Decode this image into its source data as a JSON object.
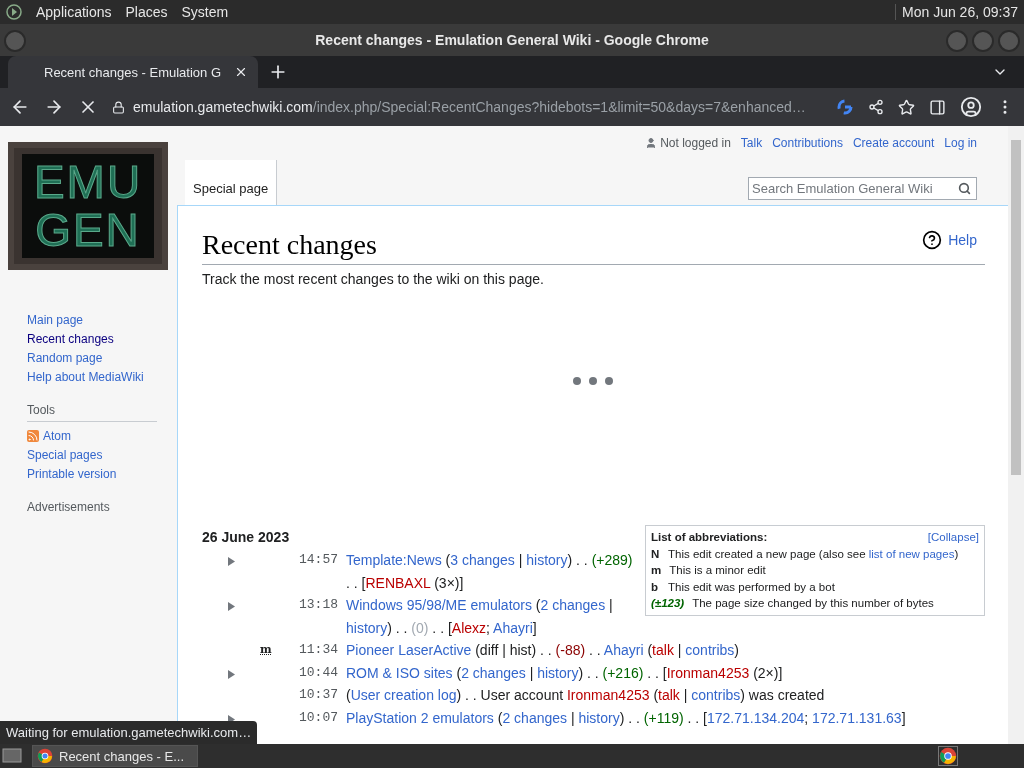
{
  "top_panel": {
    "menus": [
      "Applications",
      "Places",
      "System"
    ],
    "clock": "Mon Jun 26, 09:37"
  },
  "window": {
    "title": "Recent changes - Emulation General Wiki - Google Chrome"
  },
  "tabs": [
    {
      "label": "Recent changes - Emulation G",
      "selected": true
    }
  ],
  "address_bar": {
    "domain": "emulation.gametechwiki.com",
    "path": "/index.php/Special:RecentChanges?hidebots=1&limit=50&days=7&enhanced…"
  },
  "page": {
    "logo": [
      "EMU",
      "GEN"
    ],
    "personal_tools": [
      {
        "label": "Not logged in",
        "kind": "status"
      },
      {
        "label": "Talk",
        "kind": "link"
      },
      {
        "label": "Contributions",
        "kind": "link"
      },
      {
        "label": "Create account",
        "kind": "link"
      },
      {
        "label": "Log in",
        "kind": "link"
      }
    ],
    "namespace_tabs": [
      {
        "label": "Special page",
        "selected": true
      }
    ],
    "search": {
      "placeholder": "Search Emulation General Wiki"
    },
    "sidebar": {
      "navigation": [
        {
          "label": "Main page",
          "selected": false
        },
        {
          "label": "Recent changes",
          "selected": true
        },
        {
          "label": "Random page",
          "selected": false
        },
        {
          "label": "Help about MediaWiki",
          "selected": false
        }
      ],
      "tools_heading": "Tools",
      "tools": [
        {
          "label": "Atom",
          "kind": "feed"
        },
        {
          "label": "Special pages",
          "kind": "link"
        },
        {
          "label": "Printable version",
          "kind": "link"
        }
      ],
      "ads_heading": "Advertisements"
    },
    "heading": "Recent changes",
    "help": "Help",
    "intro": "Track the most recent changes to the wiki on this page.",
    "legend": {
      "title": "List of abbreviations:",
      "toggle": "[Collapse]",
      "items": [
        {
          "key": "N",
          "kind": "flag",
          "segments": [
            {
              "text": "This edit created a new page (also see ",
              "kind": "plain"
            },
            {
              "text": "list of new pages",
              "kind": "link"
            },
            {
              "text": ")",
              "kind": "plain"
            }
          ]
        },
        {
          "key": "m",
          "kind": "flag",
          "segments": [
            {
              "text": "This is a minor edit",
              "kind": "plain"
            }
          ]
        },
        {
          "key": "b",
          "kind": "flag",
          "segments": [
            {
              "text": "This edit was performed by a bot",
              "kind": "plain"
            }
          ]
        },
        {
          "key": "(±123)",
          "kind": "size",
          "segments": [
            {
              "text": "The page size changed by this number of bytes",
              "kind": "plain"
            }
          ]
        }
      ]
    },
    "date": "26 June 2023",
    "changes": [
      {
        "kind": "group",
        "expanded": false,
        "time": "14:57",
        "segments": [
          {
            "text": "Template:News",
            "kind": "link"
          },
          {
            "text": " (",
            "kind": "plain"
          },
          {
            "text": "3 changes",
            "kind": "link"
          },
          {
            "text": " | ",
            "kind": "plain"
          },
          {
            "text": "history",
            "kind": "link"
          },
          {
            "text": ") . . ",
            "kind": "plain"
          },
          {
            "text": "(+289)",
            "kind": "plus"
          },
          {
            "text": " . . [",
            "kind": "plain"
          },
          {
            "text": "RENBAXL",
            "kind": "new"
          },
          {
            "text": " (3×)]",
            "kind": "plain"
          }
        ]
      },
      {
        "kind": "group",
        "expanded": false,
        "time": "13:18",
        "segments": [
          {
            "text": "Windows 95/98/ME emulators",
            "kind": "link"
          },
          {
            "text": " (",
            "kind": "plain"
          },
          {
            "text": "2 changes",
            "kind": "link"
          },
          {
            "text": " | ",
            "kind": "plain"
          },
          {
            "text": "history",
            "kind": "link"
          },
          {
            "text": ") . . ",
            "kind": "plain"
          },
          {
            "text": "(0)",
            "kind": "zero"
          },
          {
            "text": " . . [",
            "kind": "plain"
          },
          {
            "text": "Alexz",
            "kind": "new"
          },
          {
            "text": "; ",
            "kind": "plain"
          },
          {
            "text": "Ahayri",
            "kind": "link"
          },
          {
            "text": "]",
            "kind": "plain"
          }
        ]
      },
      {
        "kind": "minor",
        "flag": "m",
        "time": "11:34",
        "segments": [
          {
            "text": "Pioneer LaserActive",
            "kind": "link"
          },
          {
            "text": " (diff | hist) . . ",
            "kind": "plain"
          },
          {
            "text": "(-88)",
            "kind": "minus"
          },
          {
            "text": " . . ",
            "kind": "plain"
          },
          {
            "text": "Ahayri",
            "kind": "link"
          },
          {
            "text": " (",
            "kind": "plain"
          },
          {
            "text": "talk",
            "kind": "new"
          },
          {
            "text": " | ",
            "kind": "plain"
          },
          {
            "text": "contribs",
            "kind": "link"
          },
          {
            "text": ")",
            "kind": "plain"
          }
        ]
      },
      {
        "kind": "group",
        "expanded": false,
        "time": "10:44",
        "segments": [
          {
            "text": "ROM & ISO sites",
            "kind": "link"
          },
          {
            "text": " (",
            "kind": "plain"
          },
          {
            "text": "2 changes",
            "kind": "link"
          },
          {
            "text": " | ",
            "kind": "plain"
          },
          {
            "text": "history",
            "kind": "link"
          },
          {
            "text": ") . . ",
            "kind": "plain"
          },
          {
            "text": "(+216)",
            "kind": "plus"
          },
          {
            "text": " . . [",
            "kind": "plain"
          },
          {
            "text": "Ironman4253",
            "kind": "new"
          },
          {
            "text": " (2×)]",
            "kind": "plain"
          }
        ]
      },
      {
        "kind": "log",
        "time": "10:37",
        "segments": [
          {
            "text": "(",
            "kind": "plain"
          },
          {
            "text": "User creation log",
            "kind": "link"
          },
          {
            "text": ") . . User account ",
            "kind": "plain"
          },
          {
            "text": "Ironman4253",
            "kind": "new"
          },
          {
            "text": " (",
            "kind": "plain"
          },
          {
            "text": "talk",
            "kind": "new"
          },
          {
            "text": " | ",
            "kind": "plain"
          },
          {
            "text": "contribs",
            "kind": "link"
          },
          {
            "text": ") was created",
            "kind": "plain"
          }
        ]
      },
      {
        "kind": "group",
        "expanded": false,
        "time": "10:07",
        "segments": [
          {
            "text": "PlayStation 2 emulators",
            "kind": "link"
          },
          {
            "text": " (",
            "kind": "plain"
          },
          {
            "text": "2 changes",
            "kind": "link"
          },
          {
            "text": " | ",
            "kind": "plain"
          },
          {
            "text": "history",
            "kind": "link"
          },
          {
            "text": ") . . ",
            "kind": "plain"
          },
          {
            "text": "(+119)",
            "kind": "plus"
          },
          {
            "text": " . . [",
            "kind": "plain"
          },
          {
            "text": "172.71.134.204",
            "kind": "link"
          },
          {
            "text": "; ",
            "kind": "plain"
          },
          {
            "text": "172.71.131.63",
            "kind": "link"
          },
          {
            "text": "]",
            "kind": "plain"
          }
        ]
      }
    ]
  },
  "status_bubble": "Waiting for emulation.gametechwiki.com…",
  "taskbar": {
    "tasks": [
      {
        "label": "Recent changes - E...",
        "selected": true
      }
    ]
  }
}
